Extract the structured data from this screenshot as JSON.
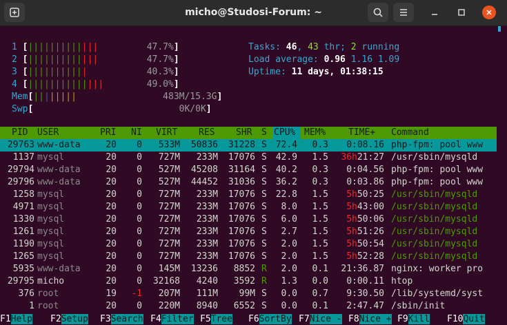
{
  "window": {
    "title": "micho@Studosi-Forum: ~"
  },
  "meters": {
    "cpus": [
      {
        "num": "1",
        "percent": "47.7%"
      },
      {
        "num": "2",
        "percent": "47.7%"
      },
      {
        "num": "3",
        "percent": "40.3%"
      },
      {
        "num": "4",
        "percent": "49.0%"
      }
    ],
    "mem": {
      "label": "Mem",
      "value": "483M/15.3G"
    },
    "swp": {
      "label": "Swp",
      "value": "0K/0K"
    }
  },
  "summary": {
    "tasks_label": "Tasks:",
    "tasks": "46",
    "threads": "43",
    "thr_label": "thr;",
    "running": "2",
    "running_label": "running",
    "load_label": "Load average:",
    "load1": "0.96",
    "load5": "1.16",
    "load15": "1.09",
    "uptime_label": "Uptime:",
    "uptime": "11 days, 01:38:15"
  },
  "columns": [
    "PID",
    "USER",
    "PRI",
    "NI",
    "VIRT",
    "RES",
    "SHR",
    "S",
    "CPU%",
    "MEM%",
    "TIME+",
    "Command"
  ],
  "processes": [
    {
      "pid": "29763",
      "user": "www-data",
      "pri": "20",
      "ni": "0",
      "virt": "533M",
      "res": "50836",
      "shr": "31228",
      "s": "S",
      "cpu": "72.4",
      "mem": "0.3",
      "time": "0:08.16",
      "cmd": "php-fpm: pool www"
    },
    {
      "pid": "1137",
      "user": "mysql",
      "pri": "20",
      "ni": "0",
      "virt": "727M",
      "res": "233M",
      "shr": "17076",
      "s": "S",
      "cpu": "42.9",
      "mem": "1.5",
      "time_h": "36h",
      "time": "21:27",
      "cmd": "/usr/sbin/mysqld"
    },
    {
      "pid": "29794",
      "user": "www-data",
      "pri": "20",
      "ni": "0",
      "virt": "527M",
      "res": "45208",
      "shr": "31164",
      "s": "S",
      "cpu": "40.2",
      "mem": "0.3",
      "time": "0:04.56",
      "cmd": "php-fpm: pool www"
    },
    {
      "pid": "29796",
      "user": "www-data",
      "pri": "20",
      "ni": "0",
      "virt": "527M",
      "res": "44452",
      "shr": "31036",
      "s": "S",
      "cpu": "36.2",
      "mem": "0.3",
      "time": "0:03.86",
      "cmd": "php-fpm: pool www"
    },
    {
      "pid": "1258",
      "user": "mysql",
      "pri": "20",
      "ni": "0",
      "virt": "727M",
      "res": "233M",
      "shr": "17076",
      "s": "S",
      "cpu": "22.8",
      "mem": "1.5",
      "time_h": "5h",
      "time": "50:25",
      "cmd": "/usr/sbin/mysqld"
    },
    {
      "pid": "4971",
      "user": "mysql",
      "pri": "20",
      "ni": "0",
      "virt": "727M",
      "res": "233M",
      "shr": "17076",
      "s": "S",
      "cpu": "8.0",
      "mem": "1.5",
      "time_h": "5h",
      "time": "43:00",
      "cmd": "/usr/sbin/mysqld"
    },
    {
      "pid": "1330",
      "user": "mysql",
      "pri": "20",
      "ni": "0",
      "virt": "727M",
      "res": "233M",
      "shr": "17076",
      "s": "S",
      "cpu": "6.0",
      "mem": "1.5",
      "time_h": "5h",
      "time": "50:06",
      "cmd": "/usr/sbin/mysqld"
    },
    {
      "pid": "1261",
      "user": "mysql",
      "pri": "20",
      "ni": "0",
      "virt": "727M",
      "res": "233M",
      "shr": "17076",
      "s": "S",
      "cpu": "2.7",
      "mem": "1.5",
      "time_h": "5h",
      "time": "51:26",
      "cmd": "/usr/sbin/mysqld"
    },
    {
      "pid": "1190",
      "user": "mysql",
      "pri": "20",
      "ni": "0",
      "virt": "727M",
      "res": "233M",
      "shr": "17076",
      "s": "S",
      "cpu": "2.0",
      "mem": "1.5",
      "time_h": "5h",
      "time": "50:54",
      "cmd": "/usr/sbin/mysqld"
    },
    {
      "pid": "1265",
      "user": "mysql",
      "pri": "20",
      "ni": "0",
      "virt": "727M",
      "res": "233M",
      "shr": "17076",
      "s": "S",
      "cpu": "2.0",
      "mem": "1.5",
      "time_h": "5h",
      "time": "52:28",
      "cmd": "/usr/sbin/mysqld"
    },
    {
      "pid": "5935",
      "user": "www-data",
      "pri": "20",
      "ni": "0",
      "virt": "145M",
      "res": "13236",
      "shr": "8852",
      "s": "R",
      "cpu": "2.0",
      "mem": "0.1",
      "time": "21:36.87",
      "cmd": "nginx: worker pro"
    },
    {
      "pid": "29795",
      "user": "micho",
      "pri": "20",
      "ni": "0",
      "virt": "32168",
      "res": "4240",
      "shr": "3592",
      "s": "R",
      "cpu": "1.3",
      "mem": "0.0",
      "time": "0:00.11",
      "cmd": "htop"
    },
    {
      "pid": "376",
      "user": "root",
      "pri": "19",
      "ni": "-1",
      "virt": "207M",
      "res": "111M",
      "shr": "99M",
      "s": "S",
      "cpu": "0.0",
      "mem": "0.7",
      "time": "9:30.50",
      "cmd": "/lib/systemd/syst"
    },
    {
      "pid": "1",
      "user": "root",
      "pri": "20",
      "ni": "0",
      "virt": "220M",
      "res": "8940",
      "shr": "6552",
      "s": "S",
      "cpu": "0.0",
      "mem": "0.1",
      "time": "2:47.47",
      "cmd": "/sbin/init"
    }
  ],
  "function_keys": [
    {
      "key": "F1",
      "label": "Help"
    },
    {
      "key": "F2",
      "label": "Setup"
    },
    {
      "key": "F3",
      "label": "Search"
    },
    {
      "key": "F4",
      "label": "Filter"
    },
    {
      "key": "F5",
      "label": "Tree"
    },
    {
      "key": "F6",
      "label": "SortBy"
    },
    {
      "key": "F7",
      "label": "Nice -"
    },
    {
      "key": "F8",
      "label": "Nice +"
    },
    {
      "key": "F9",
      "label": "Kill"
    },
    {
      "key": "F10",
      "label": "Quit"
    }
  ],
  "colors": {
    "selected_row": "#06989a",
    "header_bar": "#4e9a06",
    "terminal_bg": "#300a24",
    "close_button": "#e95420"
  }
}
